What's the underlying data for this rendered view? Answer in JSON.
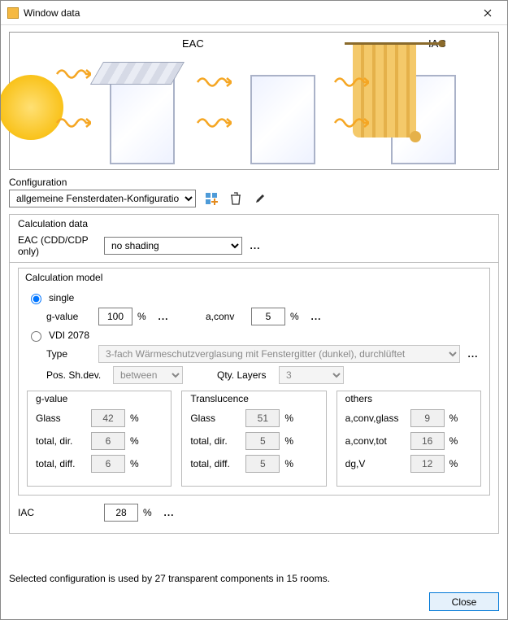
{
  "window": {
    "title": "Window data"
  },
  "illus": {
    "eac": "EAC",
    "iac": "IAC"
  },
  "configuration": {
    "label": "Configuration",
    "selected": "allgemeine Fensterdaten-Konfiguration"
  },
  "calc_data": {
    "title": "Calculation data",
    "eac_label": "EAC (CDD/CDP only)",
    "eac_value": "no shading"
  },
  "calc_model": {
    "title": "Calculation model",
    "radio_single": "single",
    "radio_vdi": "VDI 2078",
    "gvalue_label": "g-value",
    "gvalue": "100",
    "aconv_label": "a,conv",
    "aconv": "5",
    "type_label": "Type",
    "type_value": "3-fach Wärmeschutzverglasung mit Fenstergitter (dunkel), durchlüftet",
    "pos_label": "Pos. Sh.dev.",
    "pos_value": "between",
    "qty_label": "Qty. Layers",
    "qty_value": "3",
    "sub_gvalue": {
      "title": "g-value",
      "glass_lbl": "Glass",
      "glass": "42",
      "dir_lbl": "total, dir.",
      "dir": "6",
      "diff_lbl": "total, diff.",
      "diff": "6"
    },
    "sub_transl": {
      "title": "Translucence",
      "glass_lbl": "Glass",
      "glass": "51",
      "dir_lbl": "total, dir.",
      "dir": "5",
      "diff_lbl": "total, diff.",
      "diff": "5"
    },
    "sub_others": {
      "title": "others",
      "aconvglass_lbl": "a,conv,glass",
      "aconvglass": "9",
      "aconvtot_lbl": "a,conv,tot",
      "aconvtot": "16",
      "dgv_lbl": "dg,V",
      "dgv": "12"
    }
  },
  "iac": {
    "label": "IAC",
    "value": "28"
  },
  "footer": "Selected configuration is used by 27 transparent components in 15 rooms.",
  "buttons": {
    "close": "Close"
  },
  "sym": {
    "pct": "%",
    "dots": "..."
  }
}
